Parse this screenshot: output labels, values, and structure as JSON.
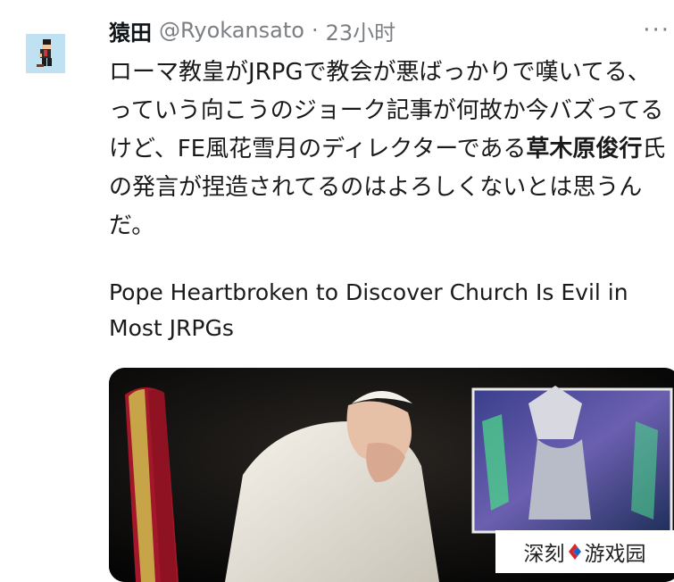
{
  "tweet": {
    "display_name": "猿田",
    "handle": "@Ryokansato",
    "separator": "·",
    "time": "23小时",
    "more_label": "···",
    "text_before": "ローマ教皇がJRPGで教会が悪ばっかりで嘆いてる、っていう向こうのジョーク記事が何故か今バズってるけど、FE風花雪月のディレクターである",
    "text_bold": "草木原俊行",
    "text_after": "氏の発言が捏造されてるのはよろしくないとは思うんだ。",
    "link_headline": "Pope Heartbroken to Discover Church Is Evil in Most JRPGs"
  },
  "watermark": {
    "left": "深刻",
    "right": "游戏园"
  },
  "colors": {
    "text": "#0f1419",
    "muted": "#7b7f83",
    "avatar_bg": "#bfe1f2",
    "chair_red": "#b0182a",
    "robe": "#efece4"
  }
}
